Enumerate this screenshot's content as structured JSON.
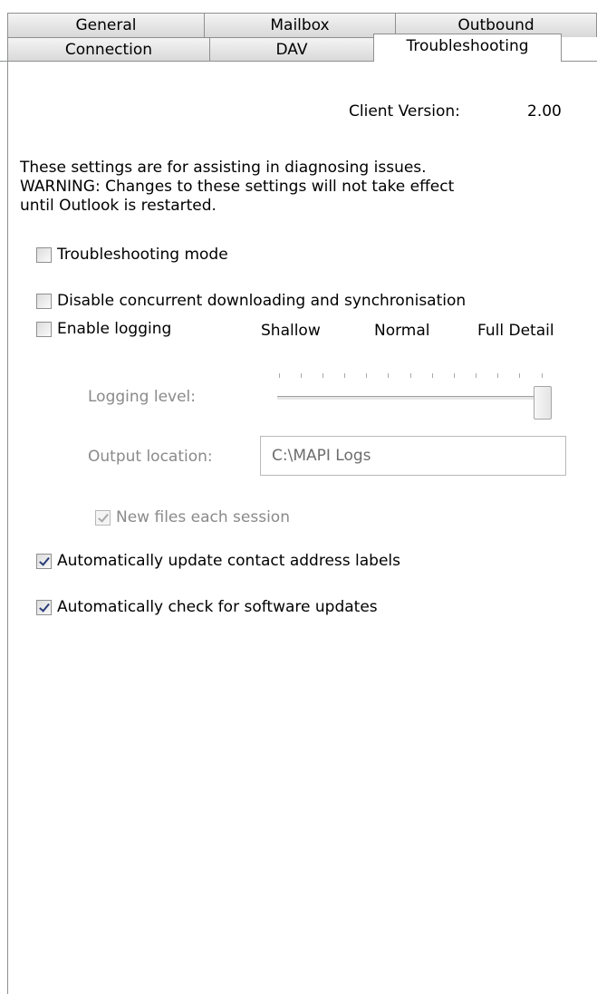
{
  "tabs": {
    "back_row": [
      "General",
      "Mailbox",
      "Outbound"
    ],
    "front_row": [
      "Connection",
      "DAV",
      "Troubleshooting"
    ],
    "selected": "Troubleshooting"
  },
  "client_version": {
    "label": "Client Version:",
    "value": "2.00"
  },
  "info": {
    "line1": "These settings are for assisting in diagnosing issues.",
    "line2": "WARNING: Changes to these settings will not take effect",
    "line3": "until Outlook is restarted."
  },
  "options": {
    "troubleshooting_mode": {
      "label": "Troubleshooting mode",
      "checked": false
    },
    "disable_concurrent": {
      "label": "Disable concurrent downloading and synchronisation",
      "checked": false
    },
    "enable_logging": {
      "label": "Enable logging",
      "checked": false
    },
    "new_files": {
      "label": "New files each session",
      "checked": true,
      "enabled": false
    },
    "auto_update_labels": {
      "label": "Automatically update contact address labels",
      "checked": true
    },
    "auto_check_updates": {
      "label": "Automatically check for software updates",
      "checked": true
    }
  },
  "logging": {
    "level_label": "Logging level:",
    "levels": [
      "Shallow",
      "Normal",
      "Full Detail"
    ],
    "level_value": 1.0,
    "output_label": "Output location:",
    "output_value": "C:\\MAPI Logs"
  }
}
